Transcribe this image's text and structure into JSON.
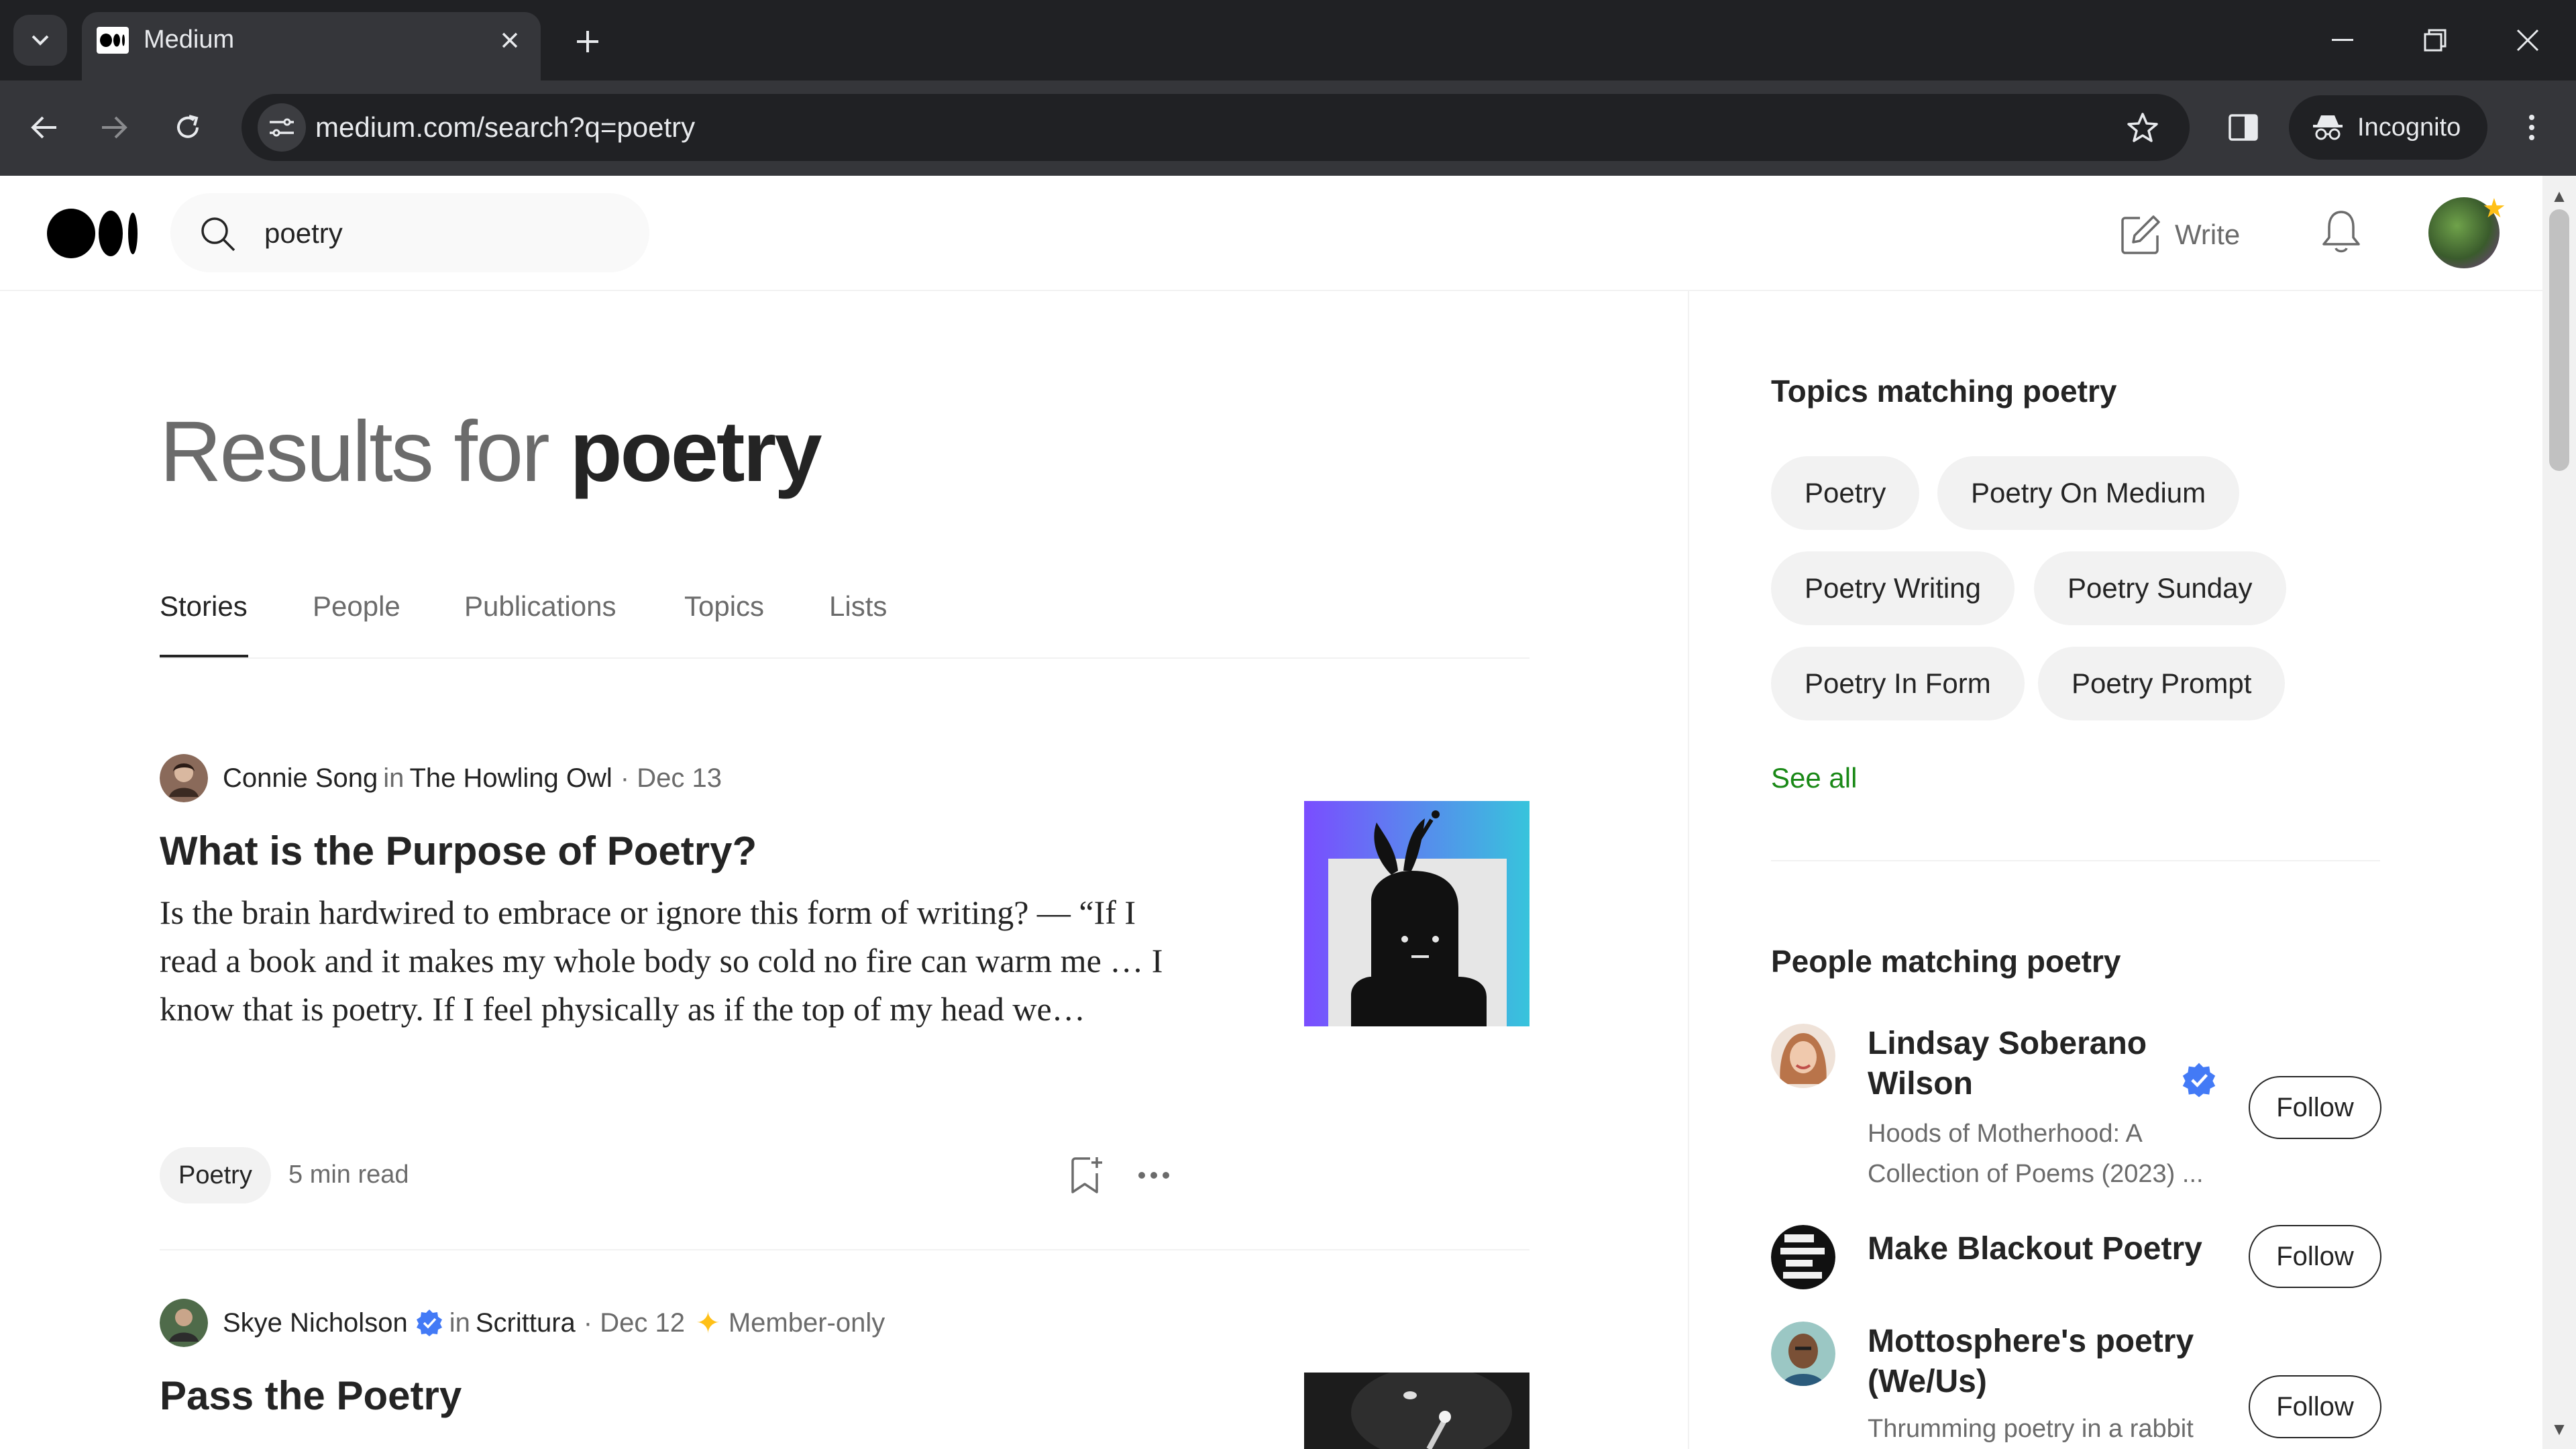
{
  "browser": {
    "tab_title": "Medium",
    "url": "medium.com/search?q=poetry",
    "incognito_label": "Incognito"
  },
  "header": {
    "search_value": "poetry",
    "write_label": "Write"
  },
  "results": {
    "heading_prefix": "Results for",
    "heading_query": "poetry",
    "tabs": [
      "Stories",
      "People",
      "Publications",
      "Topics",
      "Lists"
    ],
    "active_tab": "Stories"
  },
  "stories": [
    {
      "author": "Connie Song",
      "in_label": "in",
      "publication": "The Howling Owl",
      "date": "· Dec 13",
      "title": "What is the Purpose of Poetry?",
      "snippet": "Is the brain hardwired to embrace or ignore this form of writing? — “If I read a book and it makes my whole body so cold no fire can warm me … I know that is poetry. If I feel physically as if the top of my head we…",
      "tag": "Poetry",
      "read_time": "5 min read"
    },
    {
      "author": "Skye Nicholson",
      "in_label": "in",
      "publication": "Scrittura",
      "date": "· Dec 12",
      "member_label": "Member-only",
      "title": "Pass the Poetry"
    }
  ],
  "sidebar": {
    "topics_heading": "Topics matching poetry",
    "topics": [
      "Poetry",
      "Poetry On Medium",
      "Poetry Writing",
      "Poetry Sunday",
      "Poetry In Form",
      "Poetry Prompt"
    ],
    "see_all": "See all",
    "people_heading": "People matching poetry",
    "people": [
      {
        "name": "Lindsay Soberano Wilson",
        "bio": "Hoods of Motherhood: A Collection of Poems (2023) ...",
        "follow": "Follow"
      },
      {
        "name": "Make Blackout Poetry",
        "bio": "",
        "follow": "Follow"
      },
      {
        "name": "Mottosphere's poetry (We/Us)",
        "bio": "Thrumming poetry in a rabbit",
        "follow": "Follow"
      }
    ]
  },
  "colors": {
    "accent_green": "#1a8917",
    "text_primary": "#242424",
    "text_secondary": "#6b6b6b",
    "member_star": "#ffc017"
  }
}
